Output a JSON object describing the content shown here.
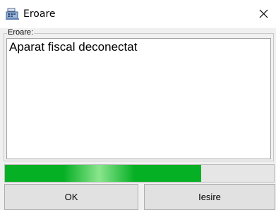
{
  "window": {
    "title": "Eroare",
    "icon": "cash-register-icon",
    "close_glyph": "✕"
  },
  "group": {
    "label": "Eroare:"
  },
  "message": {
    "text": "Aparat fiscal deconectat"
  },
  "progress": {
    "value_percent": 73,
    "color": "#06b025"
  },
  "buttons": {
    "ok_label": "OK",
    "exit_label": "Iesire"
  }
}
